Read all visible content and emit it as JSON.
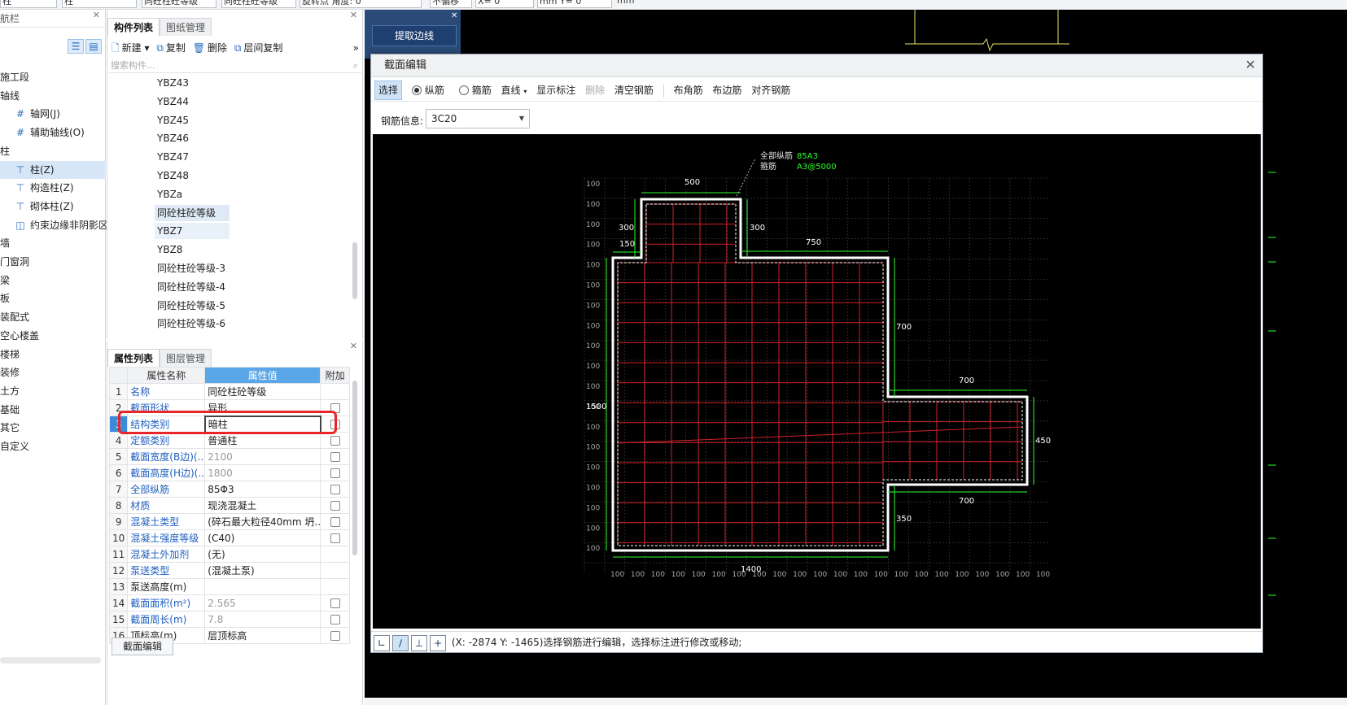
{
  "topbar": {
    "fields": [
      "柱",
      "柱",
      "同砼柱砼等级",
      "旋转点 角度: 0",
      "不偏移",
      "X= 0",
      "mm Y= 0",
      "mm"
    ]
  },
  "nav": {
    "title": "航栏",
    "items": [
      {
        "label": "施工段",
        "sub": false,
        "icon": ""
      },
      {
        "label": "轴线",
        "sub": false,
        "icon": ""
      },
      {
        "label": "轴网(J)",
        "sub": true,
        "icon": "grid-icon"
      },
      {
        "label": "辅助轴线(O)",
        "sub": true,
        "icon": "grid-icon"
      },
      {
        "label": "柱",
        "sub": false,
        "icon": ""
      },
      {
        "label": "柱(Z)",
        "sub": true,
        "icon": "column-icon",
        "selected": true
      },
      {
        "label": "构造柱(Z)",
        "sub": true,
        "icon": "column-icon"
      },
      {
        "label": "砌体柱(Z)",
        "sub": true,
        "icon": "column-icon"
      },
      {
        "label": "约束边缘非阴影区",
        "sub": true,
        "icon": "edge-icon"
      },
      {
        "label": "墙",
        "sub": false,
        "icon": ""
      },
      {
        "label": "门窗洞",
        "sub": false,
        "icon": ""
      },
      {
        "label": "梁",
        "sub": false,
        "icon": ""
      },
      {
        "label": "板",
        "sub": false,
        "icon": ""
      },
      {
        "label": "装配式",
        "sub": false,
        "icon": ""
      },
      {
        "label": "空心楼盖",
        "sub": false,
        "icon": ""
      },
      {
        "label": "楼梯",
        "sub": false,
        "icon": ""
      },
      {
        "label": "装修",
        "sub": false,
        "icon": ""
      },
      {
        "label": "土方",
        "sub": false,
        "icon": ""
      },
      {
        "label": "基础",
        "sub": false,
        "icon": ""
      },
      {
        "label": "其它",
        "sub": false,
        "icon": ""
      },
      {
        "label": "自定义",
        "sub": false,
        "icon": ""
      }
    ]
  },
  "component_panel": {
    "tabs": [
      "构件列表",
      "图纸管理"
    ],
    "toolbar": {
      "new": "新建",
      "copy": "复制",
      "delete": "删除",
      "floor_copy": "层间复制"
    },
    "search_placeholder": "搜索构件...",
    "items": [
      "YBZ43",
      "YBZ44",
      "YBZ45",
      "YBZ46",
      "YBZ47",
      "YBZ48",
      "YBZa",
      "同砼柱砼等级",
      "YBZ7",
      "YBZ8",
      "同砼柱砼等级-3",
      "同砼柱砼等级-4",
      "同砼柱砼等级-5",
      "同砼柱砼等级-6"
    ]
  },
  "property_panel": {
    "tabs": [
      "属性列表",
      "图层管理"
    ],
    "headers": {
      "name": "属性名称",
      "value": "属性值",
      "extra": "附加"
    },
    "rows": [
      {
        "num": "1",
        "name": "名称",
        "value": "同砼柱砼等级",
        "checkbox": false,
        "name_blue": true,
        "value_grey": false
      },
      {
        "num": "2",
        "name": "截面形状",
        "value": "异形",
        "checkbox": true,
        "name_blue": true,
        "value_grey": false
      },
      {
        "num": "3",
        "name": "结构类别",
        "value": "暗柱",
        "checkbox": true,
        "name_blue": true,
        "value_grey": false,
        "selected": true
      },
      {
        "num": "4",
        "name": "定额类别",
        "value": "普通柱",
        "checkbox": true,
        "name_blue": true,
        "value_grey": false
      },
      {
        "num": "5",
        "name": "截面宽度(B边)(...",
        "value": "2100",
        "checkbox": true,
        "name_blue": true,
        "value_grey": true
      },
      {
        "num": "6",
        "name": "截面高度(H边)(...",
        "value": "1800",
        "checkbox": true,
        "name_blue": true,
        "value_grey": true
      },
      {
        "num": "7",
        "name": "全部纵筋",
        "value": "85Φ3",
        "checkbox": true,
        "name_blue": true,
        "value_grey": false
      },
      {
        "num": "8",
        "name": "材质",
        "value": "现浇混凝土",
        "checkbox": true,
        "name_blue": true,
        "value_grey": false
      },
      {
        "num": "9",
        "name": "混凝土类型",
        "value": "(碎石最大粒径40mm 坍...",
        "checkbox": true,
        "name_blue": true,
        "value_grey": false
      },
      {
        "num": "10",
        "name": "混凝土强度等级",
        "value": "(C40)",
        "checkbox": true,
        "name_blue": true,
        "value_grey": false
      },
      {
        "num": "11",
        "name": "混凝土外加剂",
        "value": "(无)",
        "checkbox": false,
        "name_blue": true,
        "value_grey": false
      },
      {
        "num": "12",
        "name": "泵送类型",
        "value": "(混凝土泵)",
        "checkbox": false,
        "name_blue": true,
        "value_grey": false
      },
      {
        "num": "13",
        "name": "泵送高度(m)",
        "value": "",
        "checkbox": false,
        "name_blue": false,
        "value_grey": false
      },
      {
        "num": "14",
        "name": "截面面积(m²)",
        "value": "2.565",
        "checkbox": true,
        "name_blue": true,
        "value_grey": true
      },
      {
        "num": "15",
        "name": "截面周长(m)",
        "value": "7.8",
        "checkbox": true,
        "name_blue": true,
        "value_grey": true
      },
      {
        "num": "16",
        "name": "顶标高(m)",
        "value": "层顶标高",
        "checkbox": true,
        "name_blue": false,
        "value_grey": false
      }
    ],
    "section_edit_button": "截面编辑"
  },
  "drawing": {
    "pick_edge_button": "提取边线"
  },
  "section_dialog": {
    "title": "截面编辑",
    "toolbar": {
      "select": "选择",
      "longitudinal": "纵筋",
      "stirrup": "箍筋",
      "line": "直线",
      "show_dims": "显示标注",
      "delete": "删除",
      "clear": "清空钢筋",
      "corner": "布角筋",
      "edge": "布边筋",
      "align": "对齐钢筋"
    },
    "rebar_info_label": "钢筋信息:",
    "rebar_info_value": "3C20",
    "annotation": {
      "line1_label": "全部纵筋",
      "line1_value": "85A3",
      "line2_label": "箍筋",
      "line2_value": "A3@5000"
    },
    "dims": {
      "top": "500",
      "left_upper": "300",
      "left_notch": "150",
      "right_notch": "300",
      "shelf": "750",
      "right_drop": "700",
      "ledge_top": "700",
      "ledge_right": "450",
      "ledge_bottom": "700",
      "lower_right": "350",
      "left_total": "1500",
      "bottom_total": "1400"
    },
    "grid_tick": "100",
    "status_text": "(X: -2874 Y: -1465)选择钢筋进行编辑，选择标注进行修改或移动;"
  }
}
